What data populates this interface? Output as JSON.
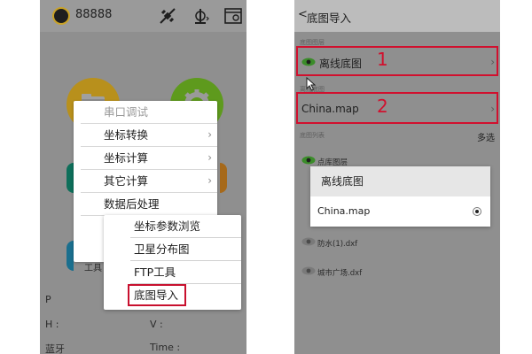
{
  "left": {
    "status": {
      "id_text": "88888"
    },
    "main_menu": {
      "items": [
        {
          "label": "串口调试",
          "header": true,
          "submenu": false
        },
        {
          "label": "坐标转换",
          "header": false,
          "submenu": true
        },
        {
          "label": "坐标计算",
          "header": false,
          "submenu": true
        },
        {
          "label": "其它计算",
          "header": false,
          "submenu": true
        },
        {
          "label": "数据后处理",
          "header": false,
          "submenu": false
        }
      ],
      "peeking_lines": [
        "工",
        "工",
        "工"
      ]
    },
    "sub_menu": {
      "items": [
        "坐标参数浏览",
        "卫星分布图",
        "FTP工具",
        "底图导入"
      ],
      "highlighted": "底图导入"
    },
    "bottom_fields": {
      "tool_label": "工具",
      "p_label": "P",
      "h_label": "H :",
      "v_label": "V :",
      "bluetooth_label": "蓝牙",
      "time_label": "Time :"
    }
  },
  "right": {
    "header": {
      "back_glyph": "<",
      "title": "底图导入"
    },
    "sections": [
      {
        "label": "底图图层"
      },
      {
        "label": "离线底图"
      },
      {
        "label": "底图列表"
      }
    ],
    "offline_row": {
      "text": "离线底图",
      "annotation": "1"
    },
    "map_row": {
      "text": "China.map",
      "annotation": "2"
    },
    "multi_select": "多选",
    "list_items": [
      "点库图层",
      "防水(1).dxf",
      "城市广场.dxf"
    ],
    "popup": {
      "title": "离线底图",
      "option": "China.map",
      "selected": true
    }
  },
  "colors": {
    "highlight_red": "#d1102e",
    "eye_green": "#3b8c2a",
    "folder_gold": "#b8901c",
    "gear_green": "#5e9a1d"
  }
}
